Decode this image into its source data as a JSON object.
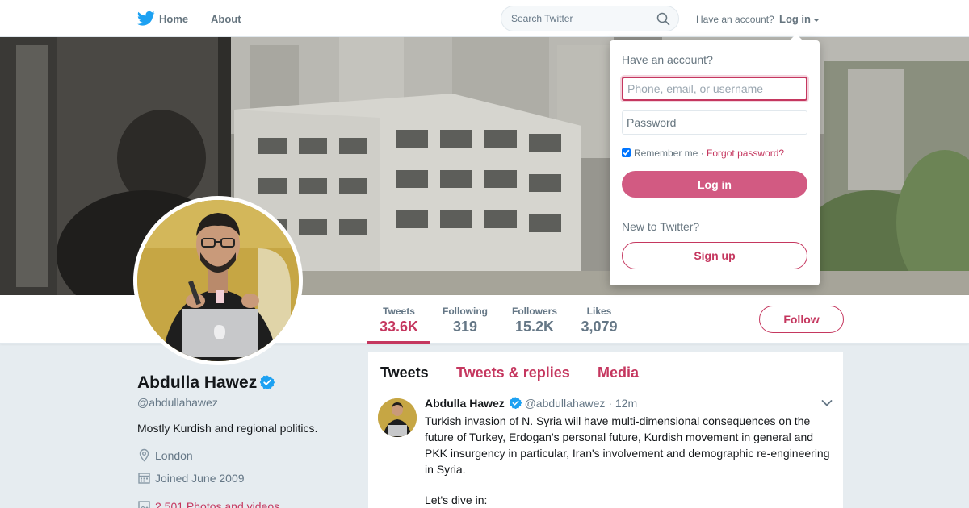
{
  "nav": {
    "home_label": "Home",
    "about_label": "About",
    "search_placeholder": "Search Twitter",
    "have_account": "Have an account?",
    "login_label": "Log in"
  },
  "profile": {
    "name": "Abdulla Hawez",
    "handle": "@abdullahawez",
    "bio": "Mostly Kurdish and regional politics.",
    "location": "London",
    "joined": "Joined June 2009",
    "media": "2,501 Photos and videos",
    "verified": true
  },
  "stats": [
    {
      "label": "Tweets",
      "value": "33.6K",
      "active": true
    },
    {
      "label": "Following",
      "value": "319",
      "active": false
    },
    {
      "label": "Followers",
      "value": "15.2K",
      "active": false
    },
    {
      "label": "Likes",
      "value": "3,079",
      "active": false
    }
  ],
  "follow_label": "Follow",
  "timeline": {
    "tabs": [
      "Tweets",
      "Tweets & replies",
      "Media"
    ],
    "active_tab": "Tweets",
    "tweet": {
      "name": "Abdulla Hawez",
      "handle": "@abdullahawez",
      "time": "12m",
      "separator": "·",
      "text": "Turkish invasion of N. Syria will have multi-dimensional consequences on the future of Turkey, Erdogan's personal future, Kurdish movement in general and PKK insurgency in particular, Iran's involvement and demographic re-engineering in Syria.",
      "text2": "Let's dive in:"
    }
  },
  "login_dropdown": {
    "heading": "Have an account?",
    "username_placeholder": "Phone, email, or username",
    "password_placeholder": "Password",
    "remember_label": "Remember me",
    "separator": "·",
    "forgot_label": "Forgot password?",
    "login_button": "Log in",
    "new_label": "New to Twitter?",
    "signup_button": "Sign up",
    "remember_checked": true
  },
  "colors": {
    "accent": "#c5375f",
    "verified_blue": "#1da1f2",
    "twitter_blue": "#1da1f2"
  }
}
